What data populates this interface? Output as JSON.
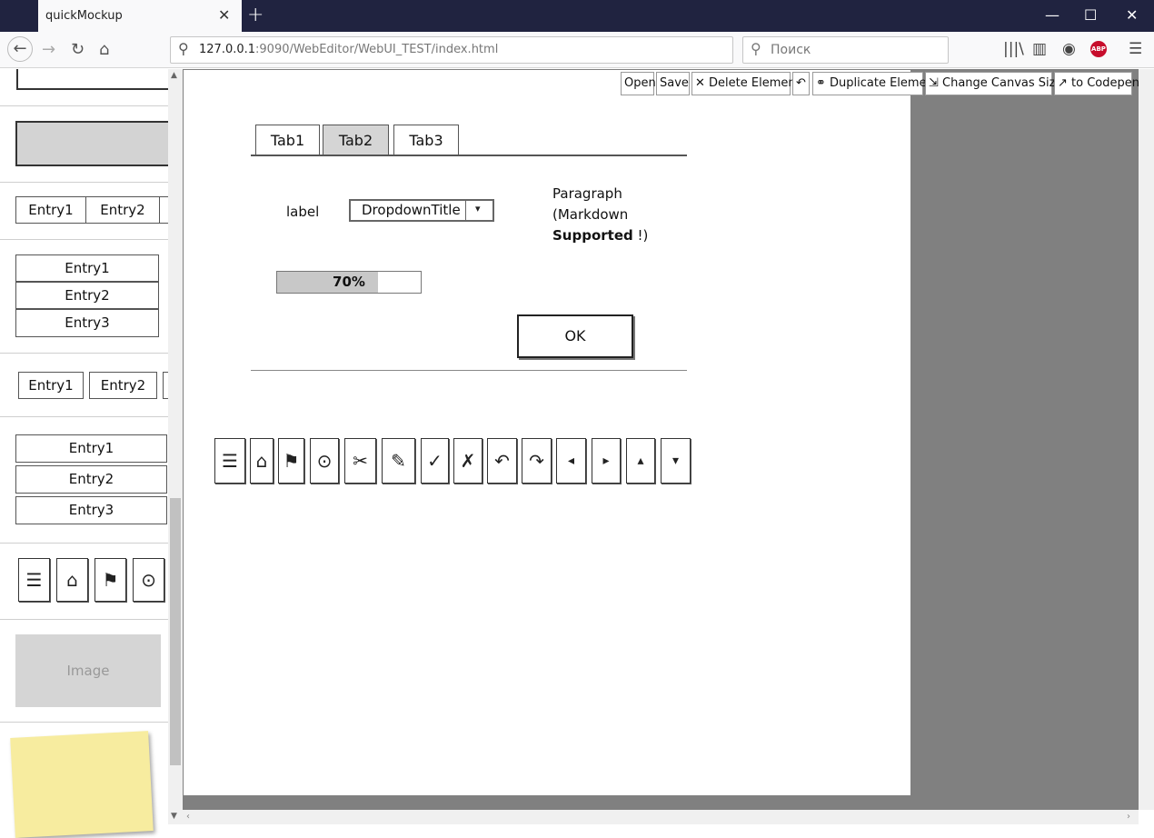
{
  "browser": {
    "tab_title": "quickMockup",
    "url_host": "127.0.0.1",
    "url_rest": ":9090/WebEditor/WebUI_TEST/index.html",
    "search_placeholder": "Поиск",
    "abp_label": "ABP"
  },
  "palette": {
    "hbar_entries": [
      "Entry1",
      "Entry2"
    ],
    "vlist_entries": [
      "Entry1",
      "Entry2",
      "Entry3"
    ],
    "buttonbar_entries": [
      "Entry1",
      "Entry2"
    ],
    "vbuttons": [
      "Entry1",
      "Entry2",
      "Entry3"
    ],
    "icons": [
      "☰",
      "⌂",
      "⚑",
      "⊙"
    ],
    "image_label": "Image"
  },
  "toolbar": {
    "open": "Open",
    "save": "Save",
    "delete": "✕ Delete Element",
    "undo": "↶",
    "duplicate": "⚭ Duplicate Element",
    "resize": "⇲ Change Canvas Size",
    "codepen": "↗ to Codepen"
  },
  "canvas": {
    "tabs": [
      "Tab1",
      "Tab2",
      "Tab3"
    ],
    "active_tab": 1,
    "label": "label",
    "dropdown_title": "DropdownTitle",
    "dropdown_arrow": "▾",
    "paragraph_line1": "Paragraph",
    "paragraph_line2": "(Markdown",
    "paragraph_bold": "Supported",
    "paragraph_tail": " !)",
    "progress_text": "70%",
    "progress_value": 0.7,
    "ok_label": "OK",
    "icon_buttons": [
      "☰",
      "⌂",
      "⚑",
      "⊙",
      "✂",
      "✎",
      "✓",
      "✗",
      "↶",
      "↷",
      "◂",
      "▸",
      "▴",
      "▾"
    ]
  }
}
